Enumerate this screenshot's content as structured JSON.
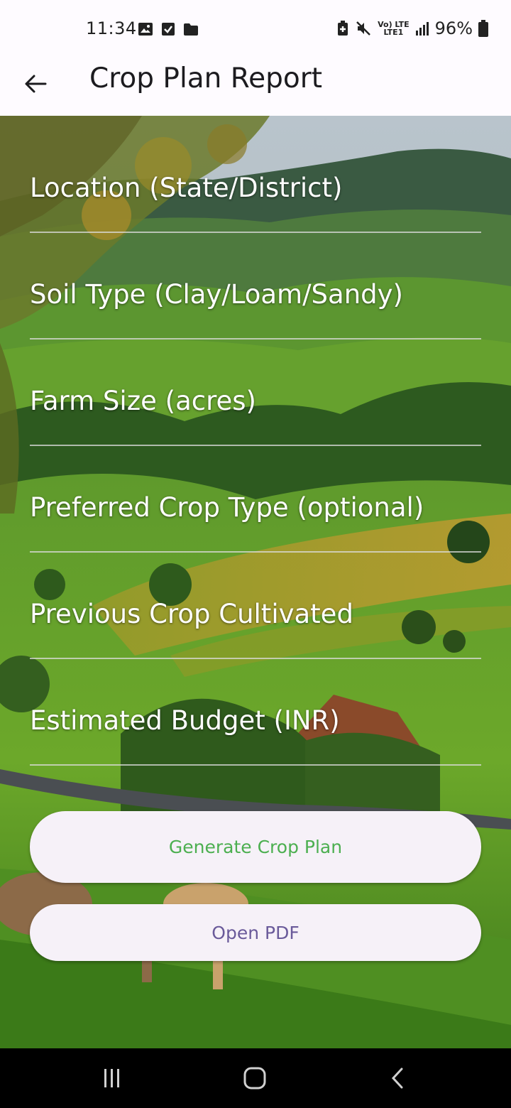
{
  "status_bar": {
    "time": "11:34",
    "network_top": "Vo) LTE",
    "network_bottom": "LTE1",
    "battery": "96%",
    "icons_left": [
      "gallery-icon",
      "checkbox-icon",
      "folder-icon"
    ],
    "icons_right": [
      "battery-saver-icon",
      "mute-icon",
      "signal-icon",
      "battery-icon"
    ]
  },
  "app_bar": {
    "title": "Crop Plan Report",
    "back_icon": "arrow-left-icon"
  },
  "form": {
    "fields": [
      {
        "label": "Location (State/District)",
        "value": ""
      },
      {
        "label": "Soil Type (Clay/Loam/Sandy)",
        "value": ""
      },
      {
        "label": "Farm Size (acres)",
        "value": ""
      },
      {
        "label": "Preferred Crop Type (optional)",
        "value": ""
      },
      {
        "label": "Previous Crop Cultivated",
        "value": ""
      },
      {
        "label": "Estimated Budget (INR)",
        "value": ""
      }
    ]
  },
  "buttons": {
    "generate": "Generate Crop Plan",
    "open_pdf": "Open PDF"
  },
  "colors": {
    "generate_text": "#4caf50",
    "pdf_text": "#6a5a9a",
    "button_bg": "#f6f1f8",
    "app_bar_bg": "#fefbff"
  },
  "nav_bar": {
    "icons": [
      "recents-icon",
      "home-icon",
      "back-icon"
    ]
  }
}
